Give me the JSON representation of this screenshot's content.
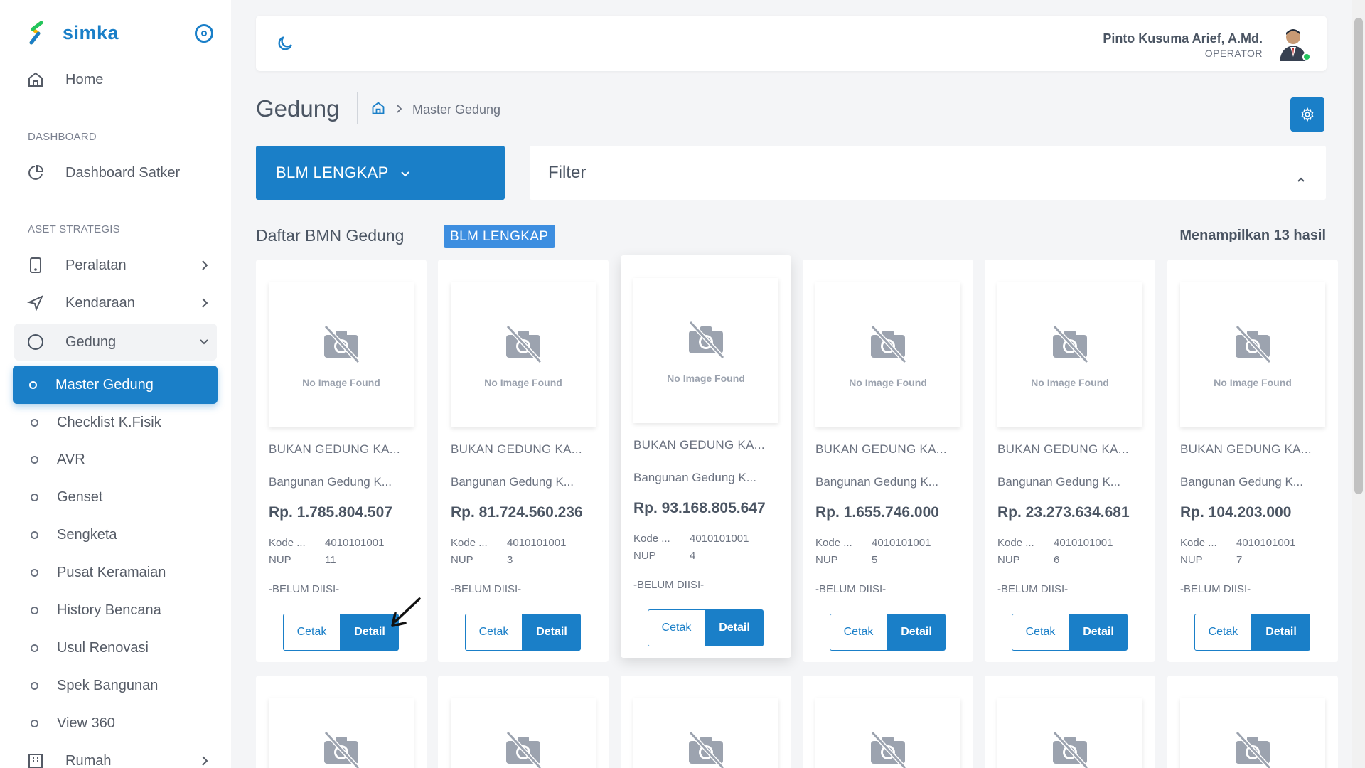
{
  "brand": {
    "name": "simka"
  },
  "sidebar": {
    "home": "Home",
    "section_dashboard": "DASHBOARD",
    "dashboard_satker": "Dashboard Satker",
    "section_aset": "ASET STRATEGIS",
    "peralatan": "Peralatan",
    "kendaraan": "Kendaraan",
    "gedung": "Gedung",
    "sub_items": [
      "Master Gedung",
      "Checklist K.Fisik",
      "AVR",
      "Genset",
      "Sengketa",
      "Pusat Keramaian",
      "History Bencana",
      "Usul Renovasi",
      "Spek Bangunan",
      "View 360"
    ],
    "rumah": "Rumah"
  },
  "header": {
    "user_name": "Pinto Kusuma Arief, A.Md.",
    "user_role": "OPERATOR"
  },
  "page": {
    "title": "Gedung",
    "breadcrumb_current": "Master Gedung",
    "status_dropdown": "BLM LENGKAP",
    "filter_label": "Filter",
    "list_title": "Daftar BMN Gedung",
    "list_badge": "BLM LENGKAP",
    "result_count": "Menampilkan 13 hasil"
  },
  "cards": [
    {
      "no_image": "No Image Found",
      "title": "BUKAN GEDUNG KA...",
      "subtitle": "Bangunan Gedung K...",
      "price": "Rp. 1.785.804.507",
      "kode_label": "Kode ...",
      "kode": "4010101001",
      "nup_label": "NUP",
      "nup": "11",
      "note": "-BELUM DIISI-",
      "cetak": "Cetak",
      "detail": "Detail"
    },
    {
      "no_image": "No Image Found",
      "title": "BUKAN GEDUNG KA...",
      "subtitle": "Bangunan Gedung K...",
      "price": "Rp. 81.724.560.236",
      "kode_label": "Kode ...",
      "kode": "4010101001",
      "nup_label": "NUP",
      "nup": "3",
      "note": "-BELUM DIISI-",
      "cetak": "Cetak",
      "detail": "Detail"
    },
    {
      "no_image": "No Image Found",
      "title": "BUKAN GEDUNG KA...",
      "subtitle": "Bangunan Gedung K...",
      "price": "Rp. 93.168.805.647",
      "kode_label": "Kode ...",
      "kode": "4010101001",
      "nup_label": "NUP",
      "nup": "4",
      "note": "-BELUM DIISI-",
      "cetak": "Cetak",
      "detail": "Detail"
    },
    {
      "no_image": "No Image Found",
      "title": "BUKAN GEDUNG KA...",
      "subtitle": "Bangunan Gedung K...",
      "price": "Rp. 1.655.746.000",
      "kode_label": "Kode ...",
      "kode": "4010101001",
      "nup_label": "NUP",
      "nup": "5",
      "note": "-BELUM DIISI-",
      "cetak": "Cetak",
      "detail": "Detail"
    },
    {
      "no_image": "No Image Found",
      "title": "BUKAN GEDUNG KA...",
      "subtitle": "Bangunan Gedung K...",
      "price": "Rp. 23.273.634.681",
      "kode_label": "Kode ...",
      "kode": "4010101001",
      "nup_label": "NUP",
      "nup": "6",
      "note": "-BELUM DIISI-",
      "cetak": "Cetak",
      "detail": "Detail"
    },
    {
      "no_image": "No Image Found",
      "title": "BUKAN GEDUNG KA...",
      "subtitle": "Bangunan Gedung K...",
      "price": "Rp. 104.203.000",
      "kode_label": "Kode ...",
      "kode": "4010101001",
      "nup_label": "NUP",
      "nup": "7",
      "note": "-BELUM DIISI-",
      "cetak": "Cetak",
      "detail": "Detail"
    }
  ],
  "colors": {
    "primary": "#1a7fc8",
    "badge": "#3d8ee0",
    "background": "#f4f5f7"
  }
}
